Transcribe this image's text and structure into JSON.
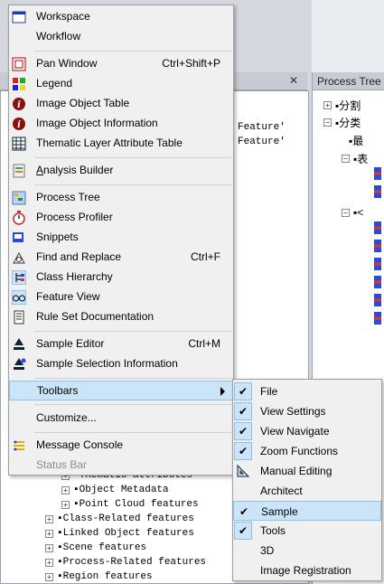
{
  "menu": {
    "items": [
      {
        "label": "Workspace",
        "icon": "workspace-icon"
      },
      {
        "label": "Workflow"
      },
      {
        "label": "Pan Window",
        "shortcut": "Ctrl+Shift+P",
        "icon": "pan-window-icon"
      },
      {
        "label": "Legend",
        "icon": "legend-icon"
      },
      {
        "label": "Image Object Table",
        "icon": "info-icon"
      },
      {
        "label": "Image Object Information",
        "icon": "info-icon"
      },
      {
        "label": "Thematic Layer Attribute Table",
        "icon": "table-icon"
      },
      {
        "label": "Analysis Builder",
        "icon": "analysis-builder-icon"
      },
      {
        "label": "Process Tree",
        "icon": "process-tree-icon"
      },
      {
        "label": "Process Profiler",
        "icon": "stopwatch-icon"
      },
      {
        "label": "Snippets",
        "icon": "snippets-icon"
      },
      {
        "label": "Find and Replace",
        "shortcut": "Ctrl+F",
        "icon": "find-replace-icon"
      },
      {
        "label": "Class Hierarchy",
        "icon": "class-hierarchy-icon"
      },
      {
        "label": "Feature View",
        "icon": "glasses-icon"
      },
      {
        "label": "Rule Set Documentation",
        "icon": "document-icon"
      },
      {
        "label": "Sample Editor",
        "shortcut": "Ctrl+M",
        "icon": "sample-editor-icon"
      },
      {
        "label": "Sample Selection Information",
        "icon": "sample-selection-icon"
      },
      {
        "label": "Toolbars",
        "submenu": true
      },
      {
        "label": "Customize..."
      },
      {
        "label": "Message Console",
        "icon": "message-console-icon"
      },
      {
        "label": "Status Bar",
        "disabled": true
      }
    ]
  },
  "submenu": {
    "items": [
      {
        "label": "File",
        "checked": true
      },
      {
        "label": "View Settings",
        "checked": true
      },
      {
        "label": "View Navigate",
        "checked": true
      },
      {
        "label": "Zoom Functions",
        "checked": true
      },
      {
        "label": "Manual Editing",
        "checked": false,
        "icon": "triangle-ruler-icon"
      },
      {
        "label": "Architect",
        "checked": false
      },
      {
        "label": "Sample",
        "checked": true
      },
      {
        "label": "Tools",
        "checked": true
      },
      {
        "label": "3D",
        "checked": false
      },
      {
        "label": "Image Registration",
        "checked": false
      }
    ]
  },
  "background": {
    "left_panel_close": "✕",
    "feature_lines": [
      "Feature'",
      "Feature'"
    ],
    "tree": [
      {
        "label": "Thematic attributes",
        "indent": 1
      },
      {
        "label": "Object Metadata",
        "indent": 1
      },
      {
        "label": "Point Cloud features",
        "indent": 1
      },
      {
        "label": "Class-Related features",
        "indent": 0
      },
      {
        "label": "Linked Object features",
        "indent": 0
      },
      {
        "label": "Scene features",
        "indent": 0
      },
      {
        "label": "Process-Related features",
        "indent": 0
      },
      {
        "label": "Region features",
        "indent": 0
      }
    ],
    "right_panel_title": "Process Tree",
    "right_tree": [
      "分割",
      "分类",
      "最",
      "表",
      "<"
    ]
  },
  "colors": {
    "highlight": "#cce4f7",
    "highlight_border": "#8fc0e8",
    "menu_bg": "#f0f0f0"
  }
}
